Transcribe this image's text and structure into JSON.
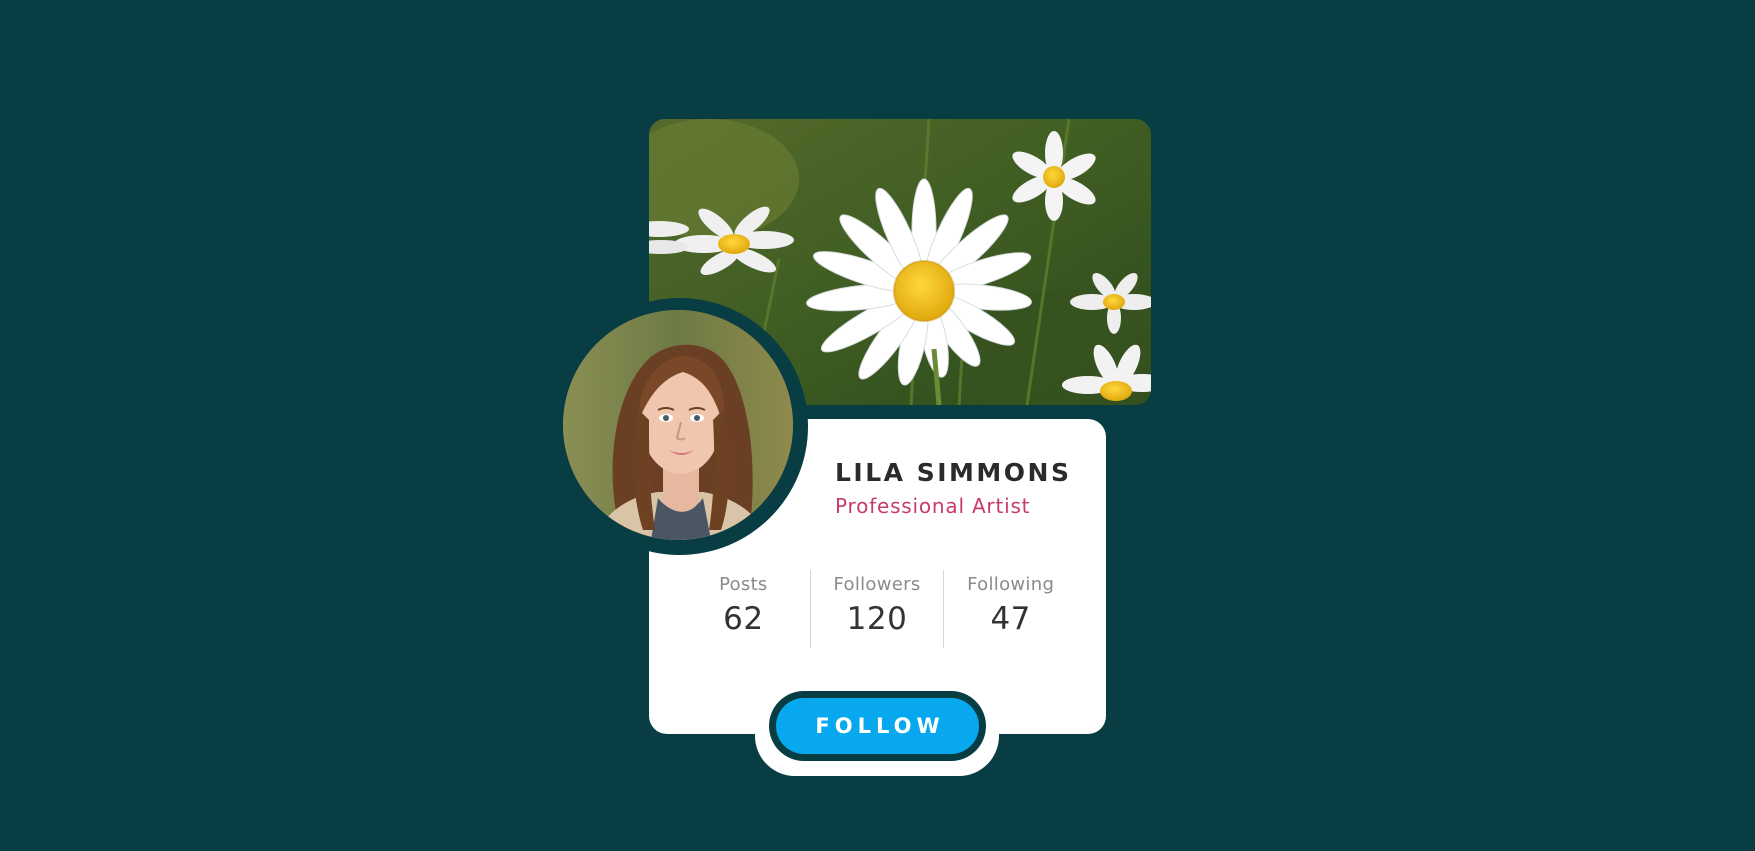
{
  "profile": {
    "name": "LILA SIMMONS",
    "role": "Professional Artist"
  },
  "stats": [
    {
      "label": "Posts",
      "value": "62"
    },
    {
      "label": "Followers",
      "value": "120"
    },
    {
      "label": "Following",
      "value": "47"
    }
  ],
  "actions": {
    "follow_label": "FOLLOW"
  },
  "colors": {
    "background": "#083d44",
    "accent": "#08a8ef",
    "role_text": "#c73b6b"
  }
}
